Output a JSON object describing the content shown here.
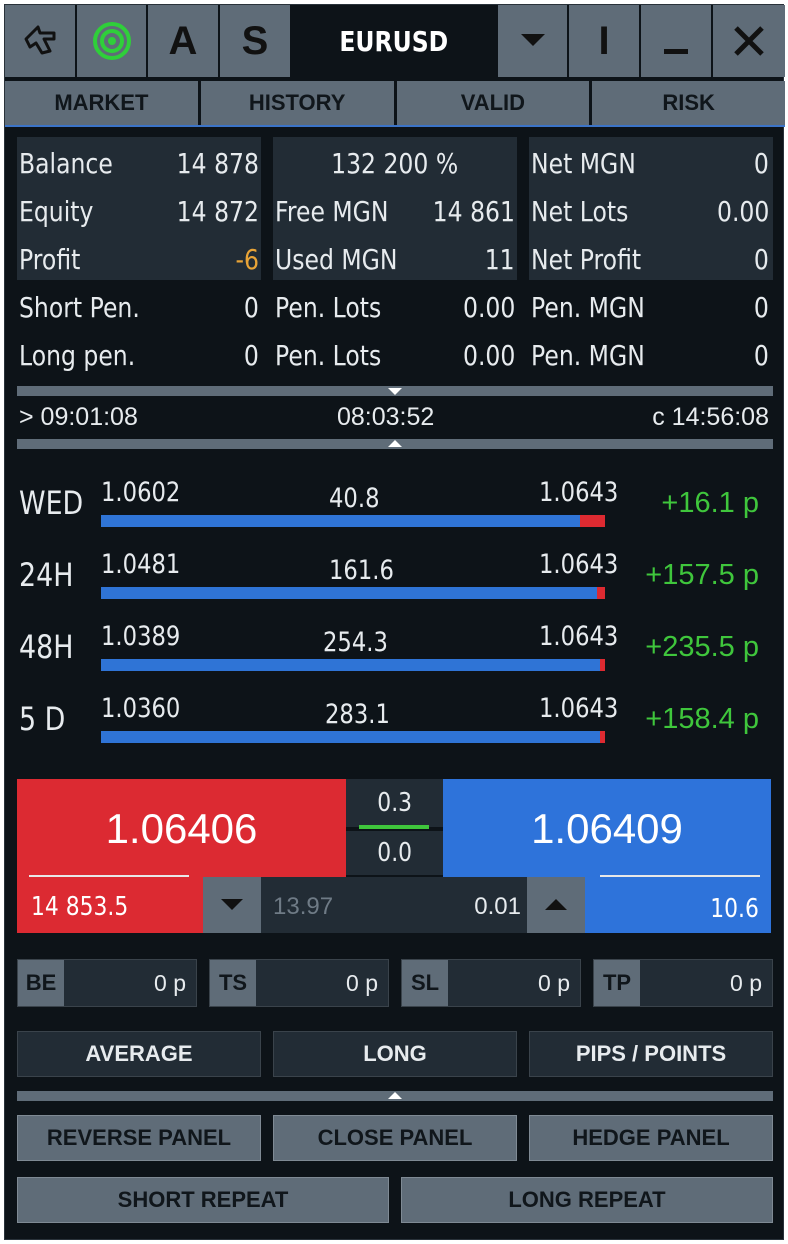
{
  "titlebar": {
    "symbol": "EURUSD",
    "a_label": "A",
    "s_label": "S",
    "i_label": "I",
    "min_label": "_",
    "close_label": "✕"
  },
  "tabs": [
    "MARKET",
    "HISTORY",
    "VALID",
    "RISK"
  ],
  "account": {
    "balance_label": "Balance",
    "balance": "14 878",
    "equity_label": "Equity",
    "equity": "14 872",
    "profit_label": "Profit",
    "profit": "-6",
    "margin_level": "132 200 %",
    "free_mgn_label": "Free MGN",
    "free_mgn": "14 861",
    "used_mgn_label": "Used MGN",
    "used_mgn": "11",
    "net_mgn_label": "Net MGN",
    "net_mgn": "0",
    "net_lots_label": "Net Lots",
    "net_lots": "0.00",
    "net_profit_label": "Net Profit",
    "net_profit": "0",
    "short_pen_label": "Short Pen.",
    "short_pen": "0",
    "long_pen_label": "Long pen.",
    "long_pen": "0",
    "pen_lots_label": "Pen. Lots",
    "pen_lots_short": "0.00",
    "pen_lots_long": "0.00",
    "pen_mgn_label": "Pen. MGN",
    "pen_mgn_short": "0",
    "pen_mgn_long": "0"
  },
  "times": {
    "left": "> 09:01:08",
    "center": "08:03:52",
    "right": "c 14:56:08"
  },
  "ranges": [
    {
      "label": "WED",
      "low": "1.0602",
      "range": "40.8",
      "high": "1.0643",
      "pips": "+16.1 p",
      "position": 0.95
    },
    {
      "label": "24H",
      "low": "1.0481",
      "range": "161.6",
      "high": "1.0643",
      "pips": "+157.5 p",
      "position": 0.985
    },
    {
      "label": "48H",
      "low": "1.0389",
      "range": "254.3",
      "high": "1.0643",
      "pips": "+235.5 p",
      "position": 0.99
    },
    {
      "label": "5 D",
      "low": "1.0360",
      "range": "283.1",
      "high": "1.0643",
      "pips": "+158.4 p",
      "position": 0.99
    }
  ],
  "trade": {
    "sell_price": "1.06406",
    "buy_price": "1.06409",
    "spread": "0.3",
    "spread_sub": "0.0",
    "sell_value": "14 853.5",
    "buy_value": "10.6",
    "lot_money": "13.97",
    "lot_size": "0.01"
  },
  "fields": [
    {
      "tag": "BE",
      "value": "0 p"
    },
    {
      "tag": "TS",
      "value": "0 p"
    },
    {
      "tag": "SL",
      "value": "0 p"
    },
    {
      "tag": "TP",
      "value": "0 p"
    }
  ],
  "buttons": {
    "average": "AVERAGE",
    "long": "LONG",
    "pips_points": "PIPS / POINTS",
    "reverse_panel": "REVERSE PANEL",
    "close_panel": "CLOSE PANEL",
    "hedge_panel": "HEDGE PANEL",
    "short_repeat": "SHORT REPEAT",
    "long_repeat": "LONG REPEAT"
  },
  "colors": {
    "red": "#dc2a32",
    "blue": "#2e73da",
    "green": "#3fc63c",
    "orange": "#e9a437"
  }
}
